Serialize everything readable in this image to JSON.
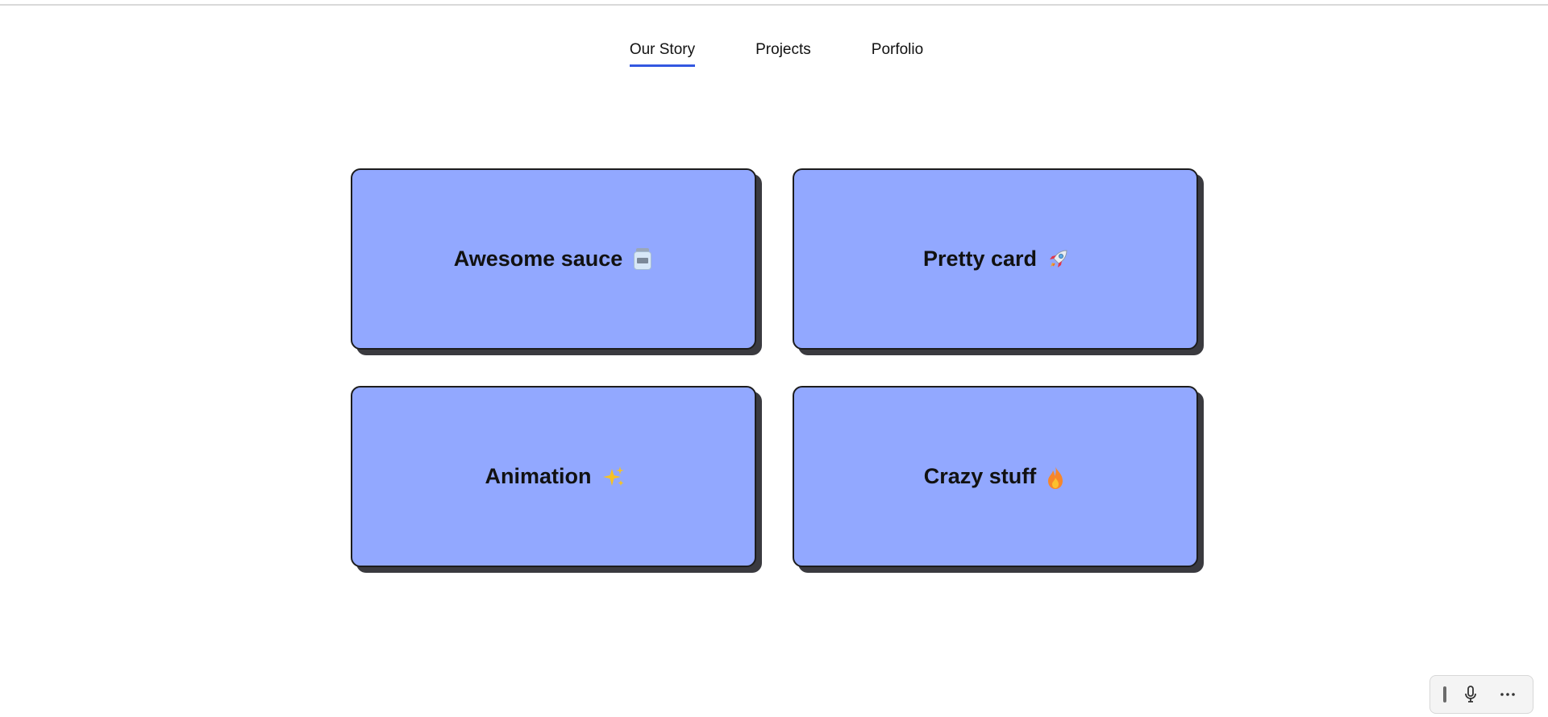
{
  "nav": {
    "tabs": [
      {
        "label": "Our Story",
        "active": true
      },
      {
        "label": "Projects",
        "active": false
      },
      {
        "label": "Porfolio",
        "active": false
      }
    ]
  },
  "cards": [
    {
      "title": "Awesome sauce",
      "icon": "jar-icon"
    },
    {
      "title": "Pretty card",
      "icon": "rocket-icon"
    },
    {
      "title": "Animation",
      "icon": "sparkles-icon"
    },
    {
      "title": "Crazy stuff",
      "icon": "fire-icon"
    }
  ],
  "colors": {
    "card_fill": "#92a8ff",
    "card_border": "#1c1c1c",
    "card_shadow": "#3a3a3f",
    "active_tab_underline": "#3357e0"
  },
  "toolbar": {
    "icons": [
      "grip-icon",
      "microphone-icon",
      "more-icon"
    ]
  }
}
